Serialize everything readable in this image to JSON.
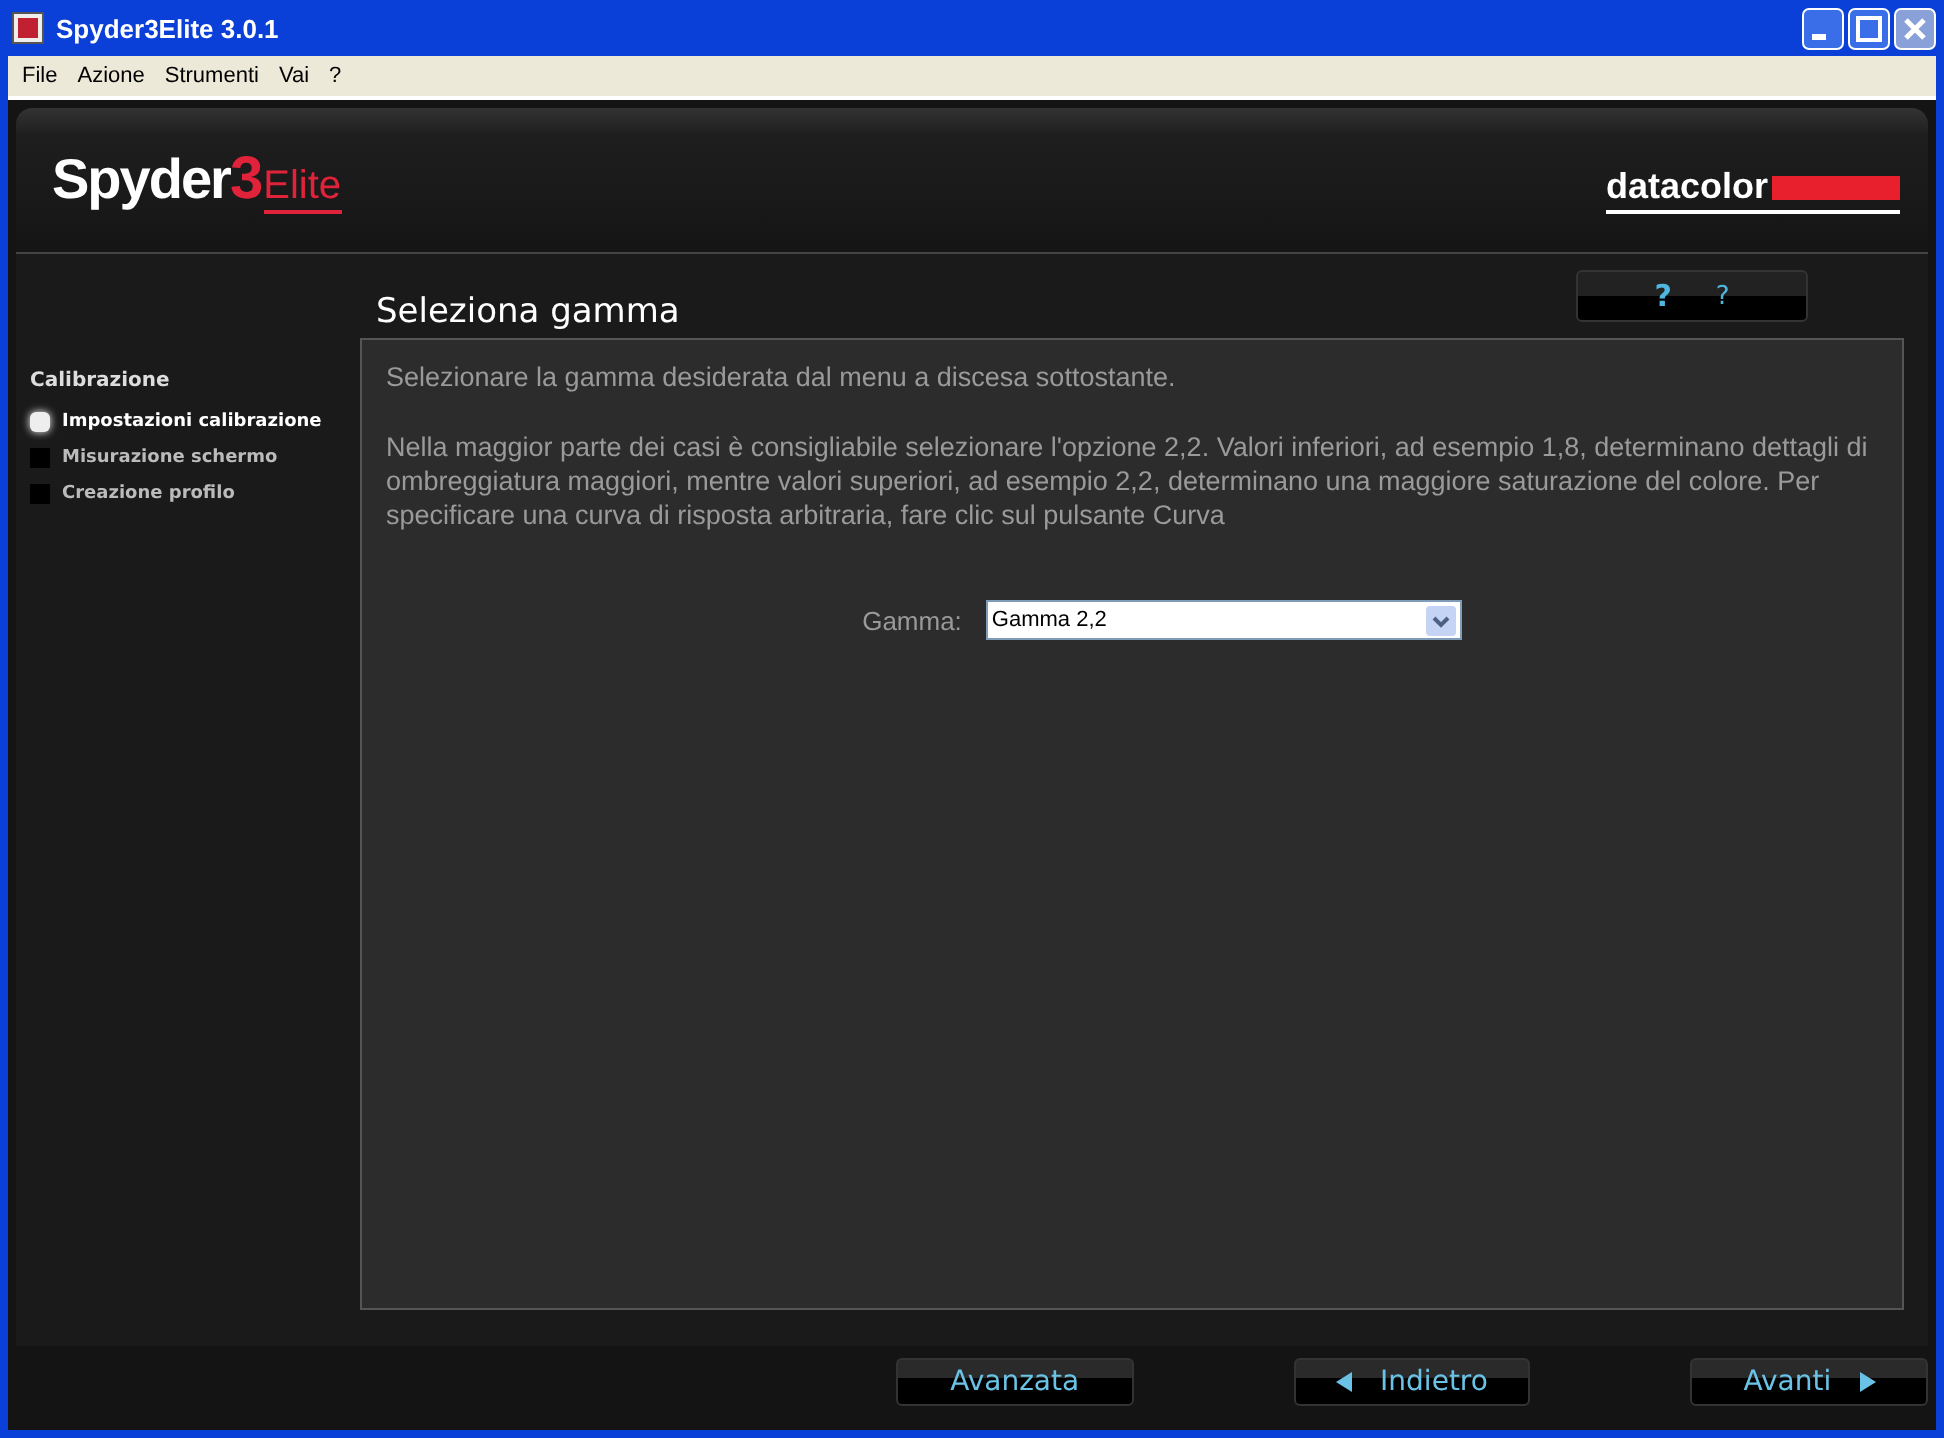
{
  "window": {
    "title": "Spyder3Elite 3.0.1"
  },
  "menu": [
    "File",
    "Azione",
    "Strumenti",
    "Vai",
    "?"
  ],
  "logo": {
    "name": "Spyder",
    "number": "3",
    "suffix": "Elite"
  },
  "brand": "datacolor",
  "help_buttons": [
    "?",
    "?"
  ],
  "sidebar": {
    "heading": "Calibrazione",
    "steps": [
      {
        "label": "Impostazioni calibrazione",
        "selected": true
      },
      {
        "label": "Misurazione schermo",
        "selected": false
      },
      {
        "label": "Creazione profilo",
        "selected": false
      }
    ]
  },
  "page_title": "Seleziona gamma",
  "paragraphs": [
    "Selezionare la gamma desiderata dal menu a discesa sottostante.",
    "Nella maggior parte dei casi è consigliabile selezionare l'opzione 2,2. Valori inferiori, ad esempio 1,8, determinano dettagli di ombreggiatura maggiori, mentre valori superiori, ad esempio 2,2, determinano una maggiore saturazione del colore. Per specificare una curva di risposta arbitraria, fare clic sul pulsante Curva"
  ],
  "gamma": {
    "label": "Gamma:",
    "value": "Gamma 2,2"
  },
  "buttons": [
    {
      "label": "Avanzata",
      "kind": "plain"
    },
    {
      "label": "Indietro",
      "kind": "back"
    },
    {
      "label": "Avanti",
      "kind": "next"
    }
  ]
}
